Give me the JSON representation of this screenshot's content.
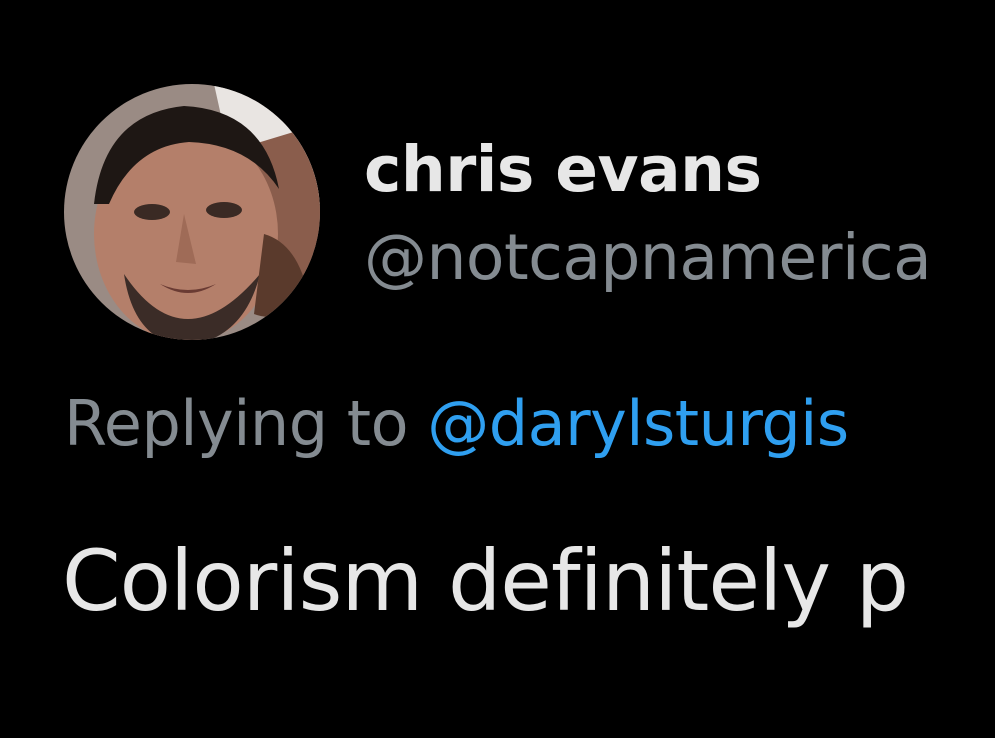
{
  "tweet": {
    "author": {
      "display_name": "chris evans",
      "handle": "@notcapnamerica"
    },
    "reply": {
      "prefix": "Replying to ",
      "mention": "@darylsturgis"
    },
    "text": "Colorism definitely p"
  },
  "theme": {
    "background": "#000000",
    "primary_text": "#e7e7e7",
    "secondary_text": "#848b91",
    "link": "#2f9ff0"
  }
}
